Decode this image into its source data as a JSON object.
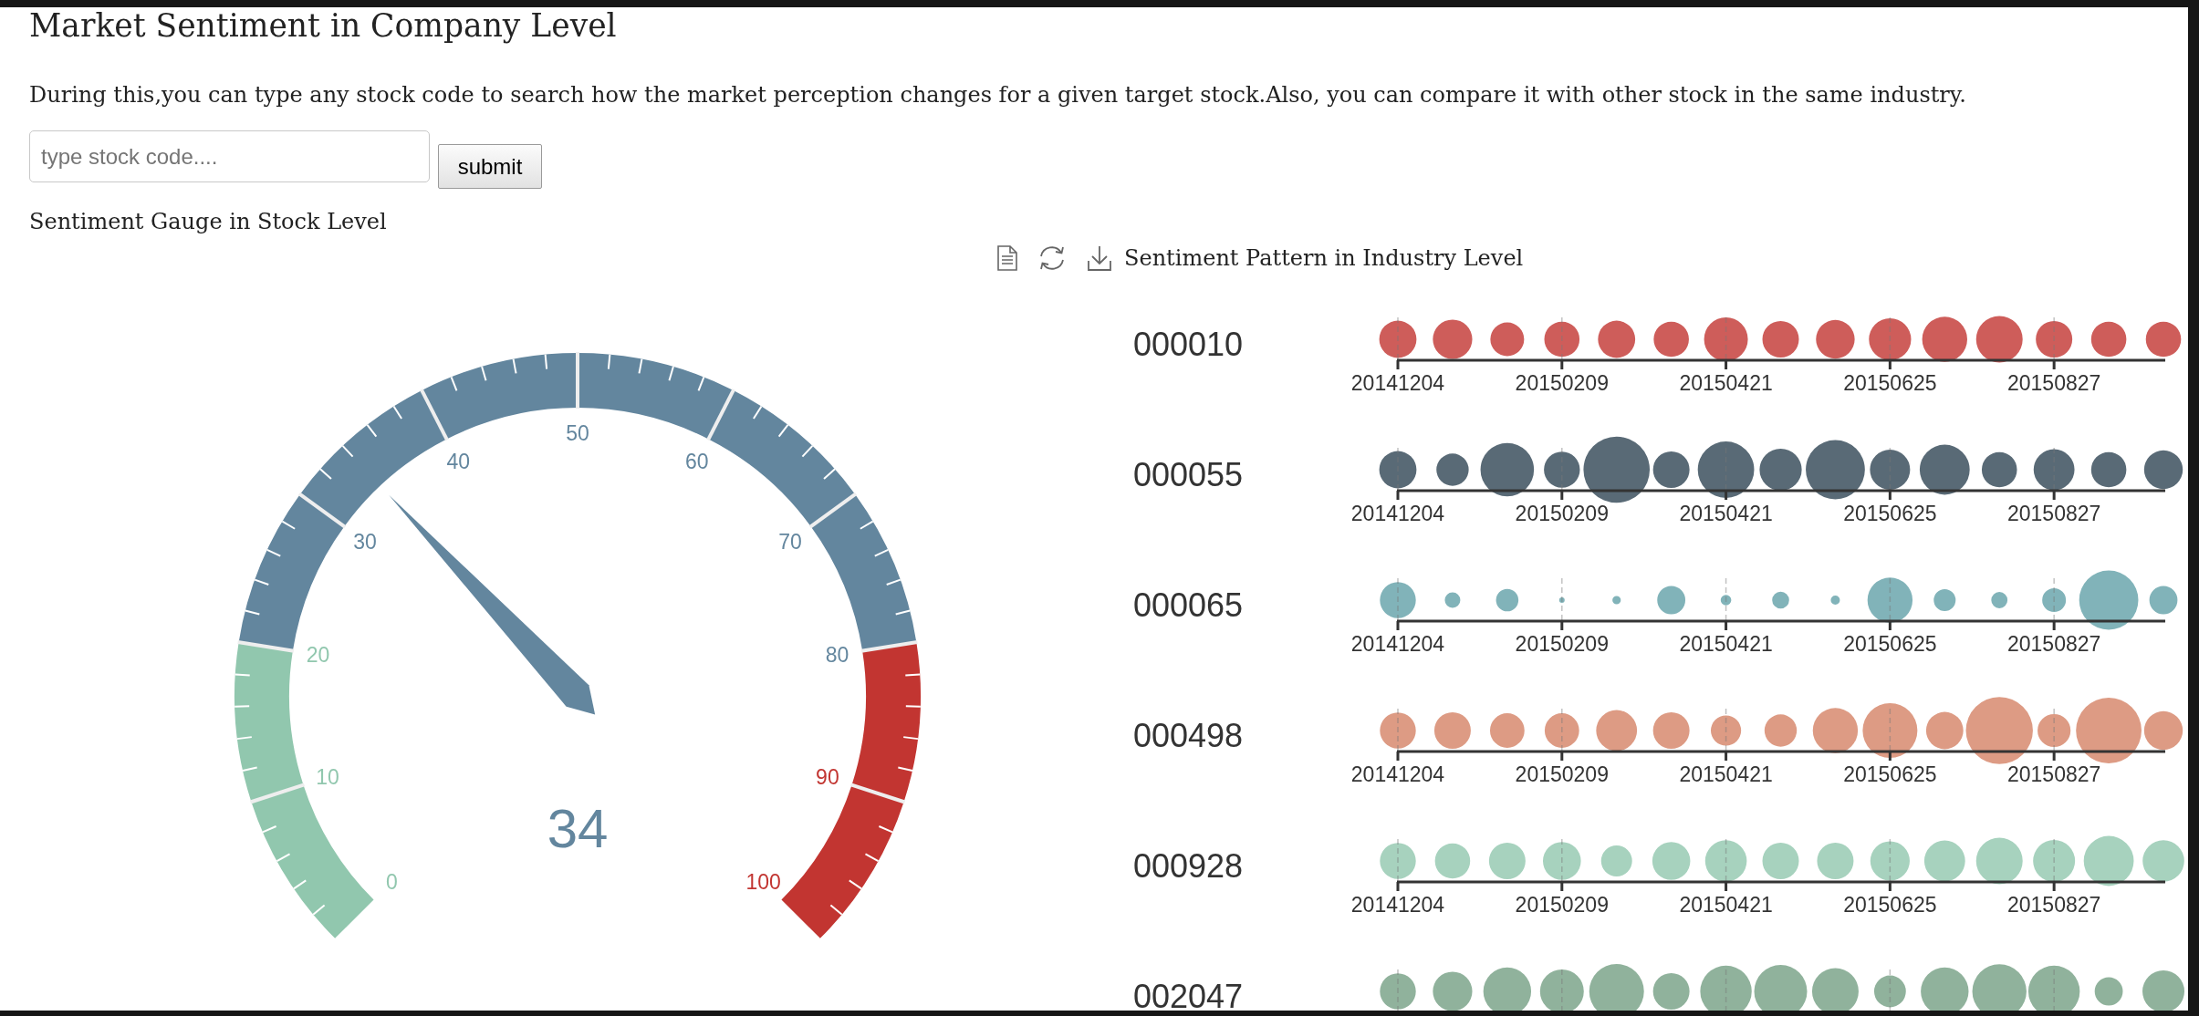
{
  "page": {
    "title": "Market Sentiment in Company Level",
    "description": "During this,you can type any stock code to search how the market perception changes for a given target stock.Also, you can compare it with other stock in the same industry."
  },
  "search": {
    "placeholder": "type stock code....",
    "button": "submit"
  },
  "gauge": {
    "title": "Sentiment Gauge in Stock Level",
    "ticks": [
      {
        "label": "0",
        "color": "#91c7ae"
      },
      {
        "label": "10",
        "color": "#91c7ae"
      },
      {
        "label": "20",
        "color": "#91c7ae"
      },
      {
        "label": "30",
        "color": "#63869e"
      },
      {
        "label": "40",
        "color": "#63869e"
      },
      {
        "label": "50",
        "color": "#63869e"
      },
      {
        "label": "60",
        "color": "#63869e"
      },
      {
        "label": "70",
        "color": "#63869e"
      },
      {
        "label": "80",
        "color": "#63869e"
      },
      {
        "label": "90",
        "color": "#c23531"
      },
      {
        "label": "100",
        "color": "#c23531"
      }
    ],
    "level": 0.34,
    "value": "34"
  },
  "industry": {
    "title": "Sentiment Pattern in Industry Level",
    "rows": [
      {
        "code": "000010",
        "color": "#ce5d5a",
        "axis_labels": [
          "20141204",
          "20150209",
          "20150421",
          "20150625",
          "20150827"
        ]
      },
      {
        "code": "000055",
        "color": "#596a76",
        "axis_labels": [
          "20141204",
          "20150209",
          "20150421",
          "20150625",
          "20150827"
        ]
      },
      {
        "code": "000065",
        "color": "#81b3b9",
        "axis_labels": [
          "20141204",
          "20150209",
          "20150421",
          "20150625",
          "20150827"
        ]
      },
      {
        "code": "000498",
        "color": "#dd9b84",
        "axis_labels": [
          "20141204",
          "20150209",
          "20150421",
          "20150625",
          "20150827"
        ]
      },
      {
        "code": "000928",
        "color": "#a7d2be",
        "axis_labels": [
          "20141204",
          "20150209",
          "20150421",
          "20150625",
          "20150827"
        ]
      },
      {
        "code": "002047",
        "color": "#90b29c"
      }
    ]
  }
}
